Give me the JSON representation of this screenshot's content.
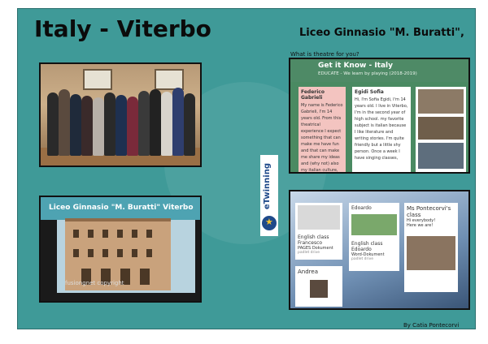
{
  "header": {
    "title": "Italy - Viterbo",
    "school": "Liceo Ginnasio \"M. Buratti\","
  },
  "question": "What is theatre for you?",
  "padlet_top": {
    "title": "Get it Know - Italy",
    "subtitle": "EDUCATE - We learn by playing (2018-2019)",
    "cards": [
      {
        "name": "Federico Gabrieli",
        "text": "My name is Federico Gabrieli, I'm 14 years old. From this theatrical experience I expect something that can make me have fun and that can make me share my ideas and (why not) also my italian culture, and above all I expect"
      },
      {
        "name": "Egidi Sofia",
        "text": "Hi, I'm Sofia Egidi, I'm 14 years old. I live in Viterbo, I'm in the second year of high school. my favorite subject is italian because I like literature and writing stories. I'm quite friendly but a little shy person. Once a week I have singing classes,"
      }
    ]
  },
  "video": {
    "title": "Liceo Ginnasio \"M. Buratti\" Viterbo",
    "watermark": "fusiongnet copyright"
  },
  "etwinning": "eTwinning",
  "padlet_bottom": {
    "cards": [
      {
        "name": "Edoardo"
      },
      {
        "name": "Ms Pontecorvi's class",
        "lines": [
          "Hi everybody!",
          "Here we are!"
        ]
      },
      {
        "name": "English class Francesco",
        "lines": [
          "PAGES Dokument",
          "padlet drive"
        ]
      },
      {
        "name": "English class Edoardo",
        "lines": [
          "Word-Dokument",
          "padlet drive"
        ]
      },
      {
        "name": "Andrea"
      }
    ]
  },
  "credit": "By Catia Pontecorvi",
  "colors": {
    "background": "#3f9a98",
    "padlet_green": "#4e8a66"
  }
}
